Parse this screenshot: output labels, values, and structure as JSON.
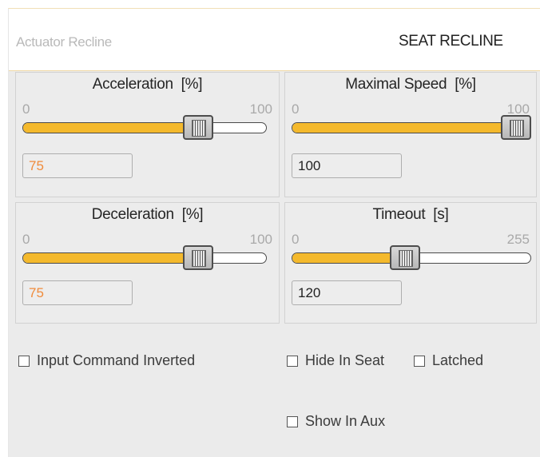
{
  "header": {
    "actuator_label": "Actuator Recline",
    "title": "SEAT RECLINE"
  },
  "sliders": [
    {
      "title": "Acceleration  [%]",
      "min": "0",
      "max": "100",
      "value": "75",
      "fraction": 0.75
    },
    {
      "title": "Maximal Speed  [%]",
      "min": "0",
      "max": "100",
      "value": "100",
      "fraction": 1.0
    },
    {
      "title": "Deceleration  [%]",
      "min": "0",
      "max": "100",
      "value": "75",
      "fraction": 0.75
    },
    {
      "title": "Timeout  [s]",
      "min": "0",
      "max": "255",
      "value": "120",
      "fraction": 0.4706
    }
  ],
  "checkboxes": {
    "input_command_inverted": {
      "label": "Input Command Inverted",
      "checked": false
    },
    "hide_in_seat": {
      "label": "Hide In Seat",
      "checked": false
    },
    "latched": {
      "label": "Latched",
      "checked": false
    },
    "show_in_aux": {
      "label": "Show In Aux",
      "checked": false
    }
  },
  "colors": {
    "slider_fill": "#f4b92c",
    "value_orange": "#f08c3c",
    "header_border": "#efd8a5"
  }
}
